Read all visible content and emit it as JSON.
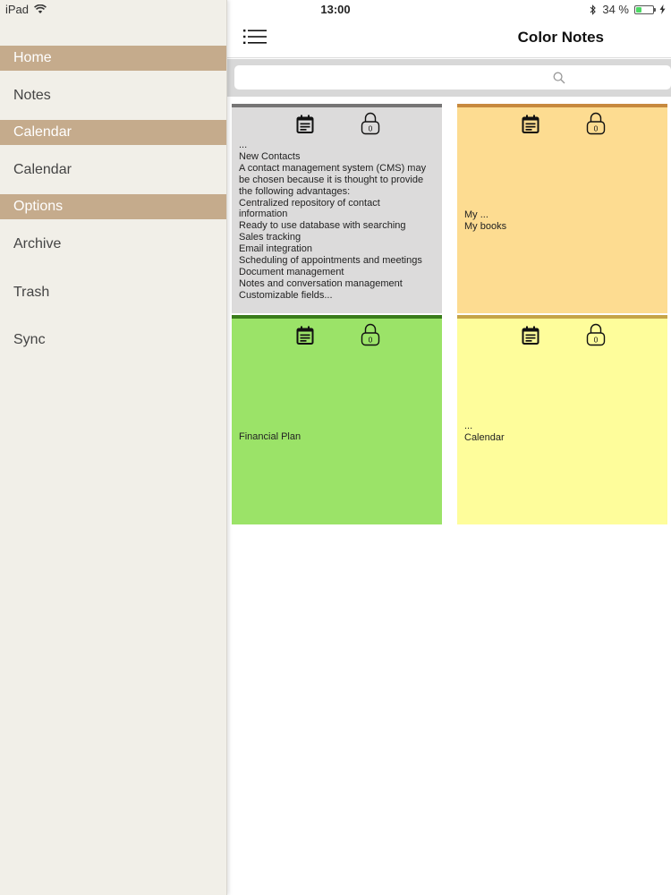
{
  "status": {
    "device": "iPad",
    "time": "13:00",
    "battery": "34 %",
    "battery_level": 0.34
  },
  "sidebar": {
    "sections": [
      {
        "header": "Home",
        "items": [
          "Notes"
        ]
      },
      {
        "header": "Calendar",
        "items": [
          "Calendar"
        ]
      },
      {
        "header": "Options",
        "items": [
          "Archive",
          "Trash",
          "Sync"
        ]
      }
    ]
  },
  "nav": {
    "title": "Color Notes"
  },
  "search": {
    "placeholder": ""
  },
  "notes": [
    {
      "color": "#dcdbdb",
      "bar_color": "#767575",
      "lock_label": "0",
      "text": "...\nNew Contacts\nA contact management system (CMS) may\nbe chosen because it is thought to provide\nthe following advantages:\nCentralized repository of contact\ninformation\nReady to use database with searching\nSales tracking\nEmail integration\nScheduling of appointments and meetings\nDocument management\nNotes and conversation management\nCustomizable fields..."
    },
    {
      "color": "#fddc91",
      "bar_color": "#c7893e",
      "lock_label": "0",
      "text": "My ...\nMy books"
    },
    {
      "color": "#9be368",
      "bar_color": "#3a7c1b",
      "lock_label": "0",
      "text": "Financial Plan"
    },
    {
      "color": "#fefd9b",
      "bar_color": "#c6a449",
      "lock_label": "0",
      "text": "...\nCalendar"
    }
  ]
}
